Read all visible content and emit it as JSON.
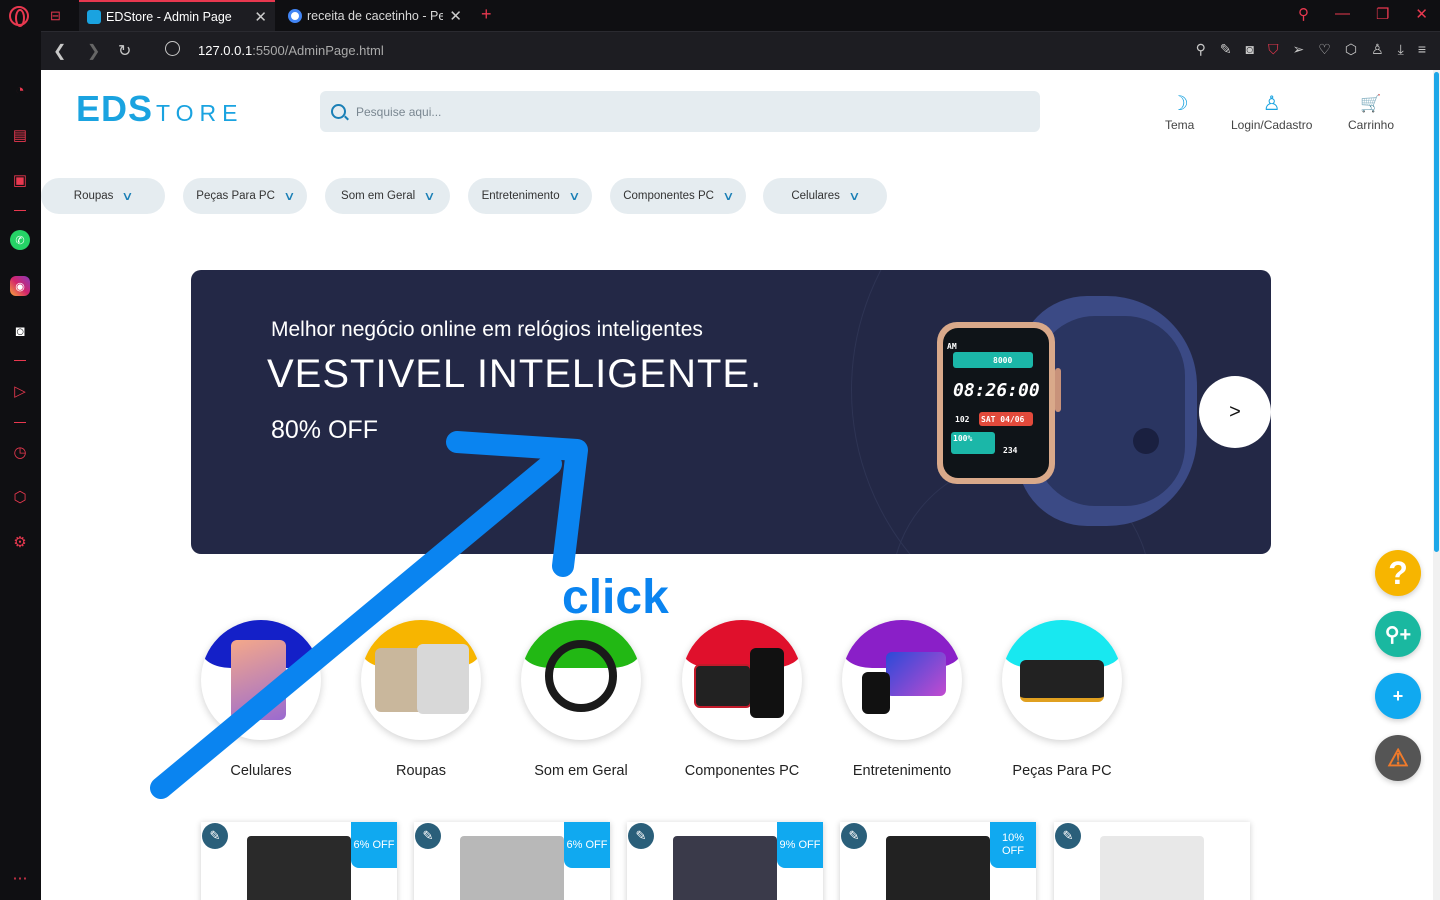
{
  "browser": {
    "tabs": [
      {
        "title": "EDStore - Admin Page",
        "active": true,
        "close": "✕"
      },
      {
        "title": "receita de cacetinho - Pesq",
        "active": false,
        "close": "✕"
      }
    ],
    "new_tab": "+",
    "url_host": "127.0.0.1",
    "url_rest": ":5500/AdminPage.html"
  },
  "header": {
    "logo_big": "EDS",
    "logo_small": "TORE",
    "search_placeholder": "Pesquise aqui...",
    "actions": [
      {
        "label": "Tema",
        "icon": "moon-icon",
        "glyph": "☽"
      },
      {
        "label": "Login/Cadastro",
        "icon": "user-icon",
        "glyph": "♙"
      },
      {
        "label": "Carrinho",
        "icon": "cart-icon",
        "glyph": "🛒"
      }
    ]
  },
  "categories_nav": [
    "Roupas",
    "Peças Para PC",
    "Som em Geral",
    "Entretenimento",
    "Componentes PC",
    "Celulares"
  ],
  "banner": {
    "subtitle": "Melhor negócio online em relógios inteligentes",
    "headline": "VESTIVEL INTELIGENTE.",
    "discount": "80% OFF",
    "next_label": ">",
    "watch": {
      "steps": "8000",
      "time": "08:26:00",
      "hr": "102",
      "date": "SAT 04/06",
      "battery": "100%",
      "cal": "234",
      "am": "AM"
    }
  },
  "annotation": {
    "text": "click",
    "color": "#0a84f0"
  },
  "category_circles": [
    {
      "label": "Celulares",
      "drip": "#1420c8"
    },
    {
      "label": "Roupas",
      "drip": "#f7b500"
    },
    {
      "label": "Som em Geral",
      "drip": "#22b814"
    },
    {
      "label": "Componentes PC",
      "drip": "#e0102c"
    },
    {
      "label": "Entretenimento",
      "drip": "#8a1fc8"
    },
    {
      "label": "Peças Para PC",
      "drip": "#18e8f0"
    }
  ],
  "products": [
    {
      "badge": "6% OFF",
      "img": "#2a2a2a"
    },
    {
      "badge": "6% OFF",
      "img": "#b8b8b8"
    },
    {
      "badge": "9% OFF",
      "img": "#3a3a4a"
    },
    {
      "badge": "10% OFF",
      "img": "#222222"
    },
    {
      "badge": "",
      "img": "#e8e8e8"
    }
  ],
  "fabs": [
    {
      "name": "help-button",
      "glyph": "?",
      "color": "#f7b500"
    },
    {
      "name": "add-user-button",
      "glyph": "⚲+",
      "color": "#1ab8a0"
    },
    {
      "name": "add-button",
      "glyph": "+",
      "color": "#10a9f0"
    },
    {
      "name": "warning-button",
      "glyph": "⚠",
      "color": "#555555"
    }
  ],
  "colors": {
    "accent": "#1aa3e0",
    "browser_accent": "#e8384f",
    "banner_bg": "#232846"
  }
}
